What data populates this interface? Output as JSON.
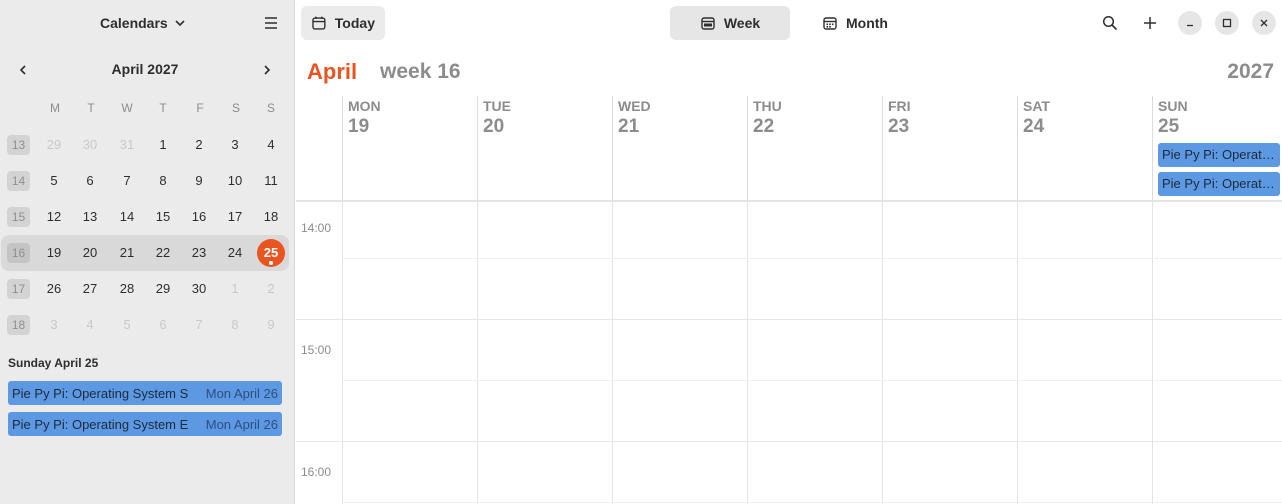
{
  "sidebar": {
    "calendars_label": "Calendars",
    "month_label": "April 2027",
    "weekdays": [
      "M",
      "T",
      "W",
      "T",
      "F",
      "S",
      "S"
    ],
    "weeks": [
      {
        "num": "13",
        "days": [
          {
            "d": "29",
            "other": true
          },
          {
            "d": "30",
            "other": true
          },
          {
            "d": "31",
            "other": true
          },
          {
            "d": "1"
          },
          {
            "d": "2"
          },
          {
            "d": "3"
          },
          {
            "d": "4"
          }
        ]
      },
      {
        "num": "14",
        "days": [
          {
            "d": "5"
          },
          {
            "d": "6"
          },
          {
            "d": "7"
          },
          {
            "d": "8"
          },
          {
            "d": "9"
          },
          {
            "d": "10"
          },
          {
            "d": "11"
          }
        ]
      },
      {
        "num": "15",
        "days": [
          {
            "d": "12"
          },
          {
            "d": "13"
          },
          {
            "d": "14"
          },
          {
            "d": "15"
          },
          {
            "d": "16"
          },
          {
            "d": "17"
          },
          {
            "d": "18"
          }
        ]
      },
      {
        "num": "16",
        "current": true,
        "days": [
          {
            "d": "19"
          },
          {
            "d": "20"
          },
          {
            "d": "21"
          },
          {
            "d": "22"
          },
          {
            "d": "23"
          },
          {
            "d": "24"
          },
          {
            "d": "25",
            "today": true
          }
        ]
      },
      {
        "num": "17",
        "days": [
          {
            "d": "26"
          },
          {
            "d": "27"
          },
          {
            "d": "28"
          },
          {
            "d": "29"
          },
          {
            "d": "30"
          },
          {
            "d": "1",
            "other": true
          },
          {
            "d": "2",
            "other": true
          }
        ]
      },
      {
        "num": "18",
        "days": [
          {
            "d": "3",
            "other": true
          },
          {
            "d": "4",
            "other": true
          },
          {
            "d": "5",
            "other": true
          },
          {
            "d": "6",
            "other": true
          },
          {
            "d": "7",
            "other": true
          },
          {
            "d": "8",
            "other": true
          },
          {
            "d": "9",
            "other": true
          }
        ]
      }
    ],
    "agenda_title": "Sunday April 25",
    "agenda": [
      {
        "title": "Pie Py Pi: Operating System S",
        "date": "Mon April 26"
      },
      {
        "title": "Pie Py Pi: Operating System E",
        "date": "Mon April 26"
      }
    ]
  },
  "toolbar": {
    "today_label": "Today",
    "week_label": "Week",
    "month_label": "Month",
    "icons": [
      "calendar-icon",
      "search-icon",
      "plus-icon",
      "minimize-icon",
      "maximize-icon",
      "close-icon"
    ]
  },
  "week_view": {
    "month": "April",
    "week": "week 16",
    "year": "2027",
    "days": [
      {
        "name": "MON",
        "num": "19"
      },
      {
        "name": "TUE",
        "num": "20"
      },
      {
        "name": "WED",
        "num": "21"
      },
      {
        "name": "THU",
        "num": "22"
      },
      {
        "name": "FRI",
        "num": "23"
      },
      {
        "name": "SAT",
        "num": "24"
      },
      {
        "name": "SUN",
        "num": "25"
      }
    ],
    "allday_events": [
      "Pie Py Pi: Operating System S",
      "Pie Py Pi: Operating System E"
    ],
    "time_labels": [
      "14:00",
      "15:00",
      "16:00"
    ]
  },
  "colors": {
    "accent": "#e95420",
    "event": "#5c99e2",
    "sidebar_bg": "#ebebeb"
  }
}
